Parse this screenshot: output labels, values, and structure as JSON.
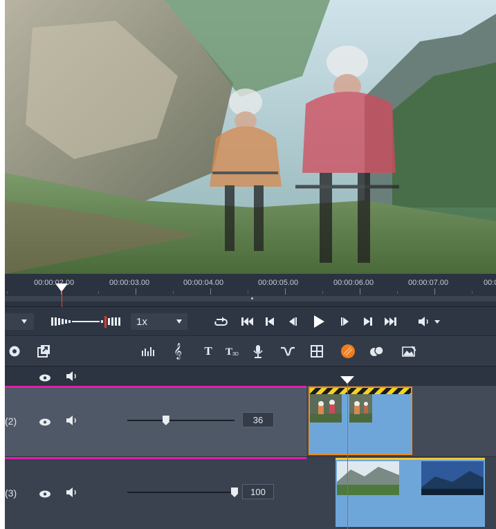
{
  "ruler": {
    "timecodes": [
      "00:00:02.00",
      "00:00:03.00",
      "00:00:04.00",
      "00:00:05.00",
      "00:00:06.00",
      "00:00:07.00",
      "00:0"
    ]
  },
  "transport": {
    "speed": "1x"
  },
  "tracks": [
    {
      "label": "(2)",
      "volume": "36",
      "volume_level": 0.36
    },
    {
      "label": "(3)",
      "volume": "100",
      "volume_level": 1.0
    }
  ],
  "colors": {
    "accent_magenta": "#e21fae",
    "clip_selected_border": "#ef8d1f",
    "playhead": "#e0502b",
    "clip_fill": "#6fa6da"
  },
  "icons": {
    "transport": [
      "loop-icon",
      "go-to-start-icon",
      "previous-marker-icon",
      "step-back-icon",
      "play-icon",
      "step-forward-icon",
      "next-marker-icon",
      "go-to-end-icon",
      "speaker-icon"
    ],
    "toolbar": [
      "disc-icon",
      "export-icon",
      "audio-mixer-icon",
      "music-score-icon",
      "title-icon",
      "title-3d-icon",
      "microphone-icon",
      "transition-icon",
      "split-grid-icon",
      "color-icon",
      "overlay-icon",
      "image-edit-icon"
    ]
  }
}
